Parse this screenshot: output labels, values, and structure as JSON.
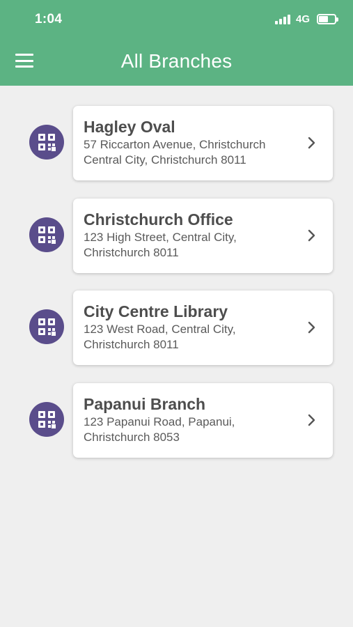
{
  "status_bar": {
    "time": "1:04",
    "network": "4G",
    "battery_level": 0.6
  },
  "header": {
    "title": "All Branches",
    "menu_icon": "hamburger-menu-icon",
    "color": "#5cb383"
  },
  "accent_color": "#5a4d8b",
  "branches": [
    {
      "name": "Hagley Oval",
      "address": "57 Riccarton Avenue, Christchurch Central City, Christchurch 8011",
      "icon": "qr-code-icon"
    },
    {
      "name": "Christchurch Office",
      "address": "123 High Street, Central City, Christchurch 8011",
      "icon": "qr-code-icon"
    },
    {
      "name": "City Centre Library",
      "address": "123 West Road, Central City, Christchurch 8011",
      "icon": "qr-code-icon"
    },
    {
      "name": "Papanui Branch",
      "address": "123 Papanui Road, Papanui, Christchurch 8053",
      "icon": "qr-code-icon"
    }
  ]
}
